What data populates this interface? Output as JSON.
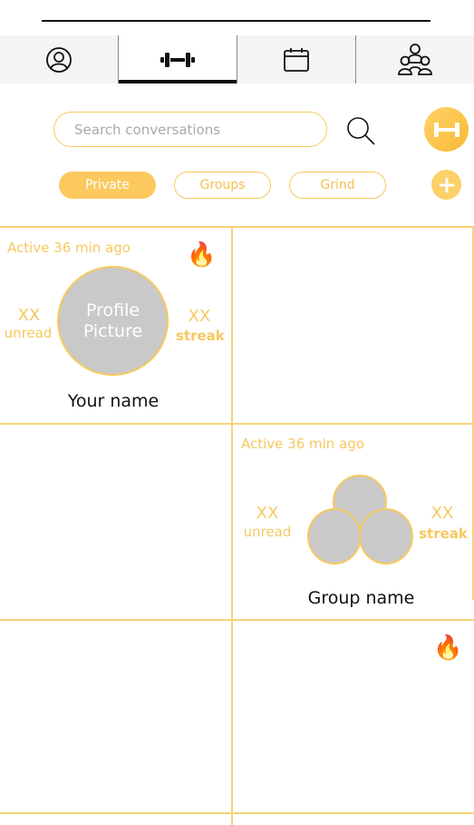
{
  "nav": {
    "tabs": [
      {
        "name": "profile",
        "icon": "user-circle-icon"
      },
      {
        "name": "workout",
        "icon": "dumbbell-icon",
        "active": true
      },
      {
        "name": "calendar",
        "icon": "calendar-icon"
      },
      {
        "name": "community",
        "icon": "group-icon"
      }
    ]
  },
  "search": {
    "placeholder": "Search conversations",
    "icon": "search-icon"
  },
  "filters": [
    {
      "label": "Private",
      "active": true
    },
    {
      "label": "Groups",
      "active": false
    },
    {
      "label": "Grind",
      "active": false
    }
  ],
  "cards": {
    "private": {
      "active": "Active 36 min ago",
      "unread_count": "XX",
      "unread_label": "unread",
      "streak_count": "XX",
      "streak_label": "streak",
      "picture_line1": "Profile",
      "picture_line2": "Picture",
      "name": "Your name"
    },
    "group": {
      "active": "Active 36 min ago",
      "unread_count": "XX",
      "unread_label": "unread",
      "streak_count": "XX",
      "streak_label": "streak",
      "name": "Group name"
    }
  },
  "colors": {
    "accent": "#f7c95f",
    "placeholder_gray": "#c9c9c9"
  }
}
